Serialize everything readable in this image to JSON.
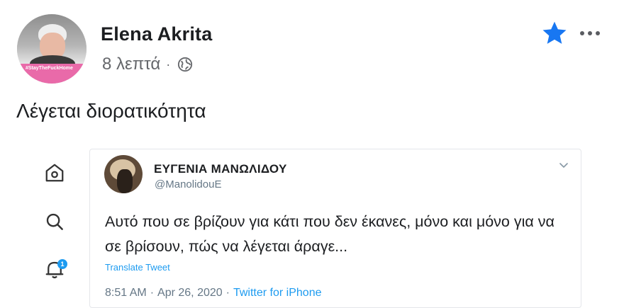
{
  "post": {
    "author_name": "Elena Akrita",
    "time_ago": "8 λεπτά",
    "separator": "·",
    "visibility_icon": "globe-icon",
    "text": "Λέγεται διορατικότητα",
    "avatar_banner_text": "#StayTheFuckHome",
    "favorite_icon": "star-icon",
    "favorite_color": "#1877f2",
    "more_icon": "more-horizontal-icon"
  },
  "sidebar_icons": [
    "home-icon",
    "search-icon",
    "notifications-icon"
  ],
  "notification_badge": "1",
  "tweet": {
    "author_name": "ΕΥΓΕΝΙΑ ΜΑΝΩΛΙΔΟΥ",
    "handle": "@ManolidouE",
    "text": "Αυτό που σε βρίζουν για κάτι που δεν έκανες, μόνο και μόνο για να σε βρίσουν, πώς να λέγεται άραγε...",
    "translate_label": "Translate Tweet",
    "time": "8:51 AM",
    "separator": "·",
    "date": "Apr 26, 2020",
    "source": "Twitter for iPhone",
    "link_color": "#1d9bf0"
  }
}
